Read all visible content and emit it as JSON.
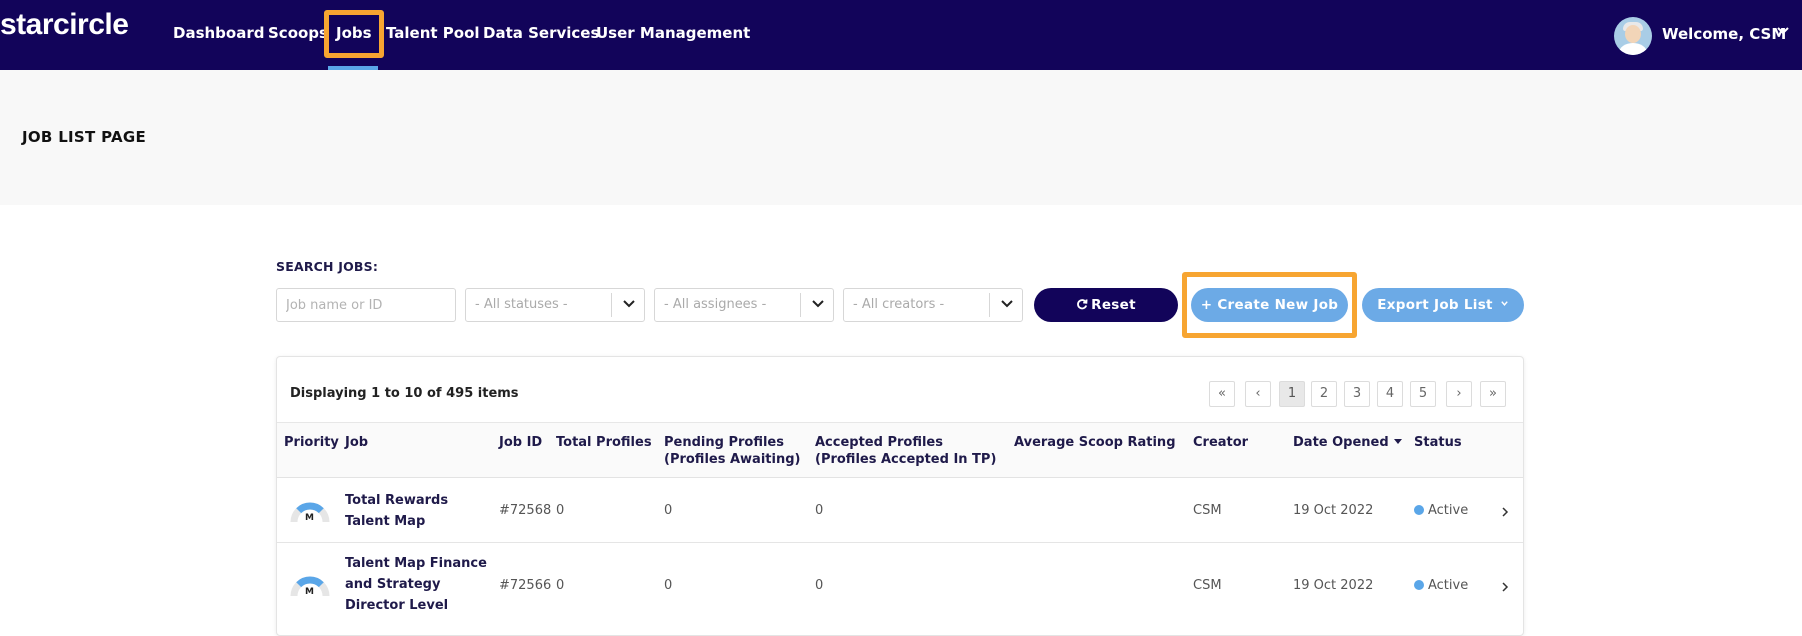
{
  "nav": {
    "logo": "starcircle",
    "items": [
      "Dashboard",
      "Scoops",
      "Jobs",
      "Talent Pool",
      "Data Services",
      "User Management"
    ],
    "active": "Jobs",
    "welcome": "Welcome, CSM"
  },
  "page": {
    "title": "JOB LIST PAGE"
  },
  "search": {
    "label": "SEARCH JOBS:",
    "job_placeholder": "Job name or ID",
    "status_value": "- All statuses -",
    "assignee_value": "- All assignees -",
    "creator_value": "- All creators -",
    "reset_label": "Reset",
    "create_label": "Create New Job",
    "export_label": "Export Job List"
  },
  "table": {
    "displaying": "Displaying 1 to 10 of 495 items",
    "pages": [
      "1",
      "2",
      "3",
      "4",
      "5"
    ],
    "current_page": "1",
    "headers": {
      "priority": "Priority",
      "job": "Job",
      "job_id": "Job ID",
      "total_profiles": "Total Profiles",
      "pending_1": "Pending Profiles",
      "pending_2": "(Profiles Awaiting)",
      "accepted_1": "Accepted Profiles",
      "accepted_2": "(Profiles Accepted In TP)",
      "avg_rating": "Average Scoop Rating",
      "creator": "Creator",
      "date_opened": "Date Opened",
      "status": "Status"
    },
    "rows": [
      {
        "priority": "M",
        "job": "Total Rewards Talent Map",
        "job_id": "#72568",
        "total": "0",
        "pending": "0",
        "accepted": "0",
        "rating": "",
        "creator": "CSM",
        "date": "19 Oct 2022",
        "status": "Active"
      },
      {
        "priority": "M",
        "job": "Talent Map Finance and Strategy Director Level",
        "job_id": "#72566",
        "total": "0",
        "pending": "0",
        "accepted": "0",
        "rating": "",
        "creator": "CSM",
        "date": "19 Oct 2022",
        "status": "Active"
      }
    ]
  },
  "colors": {
    "navbar": "#12045a",
    "accent": "#6caae6",
    "highlight": "#f7a531",
    "status_active": "#5aa6e8"
  }
}
